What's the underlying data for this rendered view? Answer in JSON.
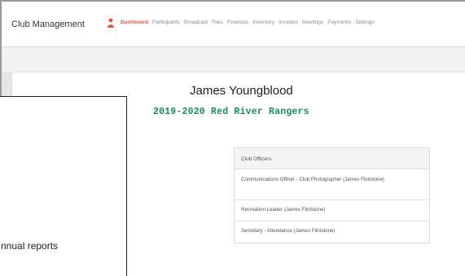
{
  "app": {
    "brand": "Club Management"
  },
  "nav": {
    "items": [
      {
        "label": "Dashboard",
        "active": true
      },
      {
        "label": "Participants",
        "active": false
      },
      {
        "label": "Broadcast",
        "active": false
      },
      {
        "label": "Files",
        "active": false
      },
      {
        "label": "Finances",
        "active": false
      },
      {
        "label": "Inventory",
        "active": false
      },
      {
        "label": "Invoices",
        "active": false
      },
      {
        "label": "Meetings",
        "active": false
      },
      {
        "label": "Payments",
        "active": false
      },
      {
        "label": "Settings",
        "active": false
      }
    ],
    "user_icon": "user-icon"
  },
  "profile": {
    "name": "James Youngblood",
    "team": "2019-2020 Red River Rangers"
  },
  "officers": {
    "header": "Club Officers",
    "items": [
      "Communications Officer - Club Photographer (James Flintstone)",
      "Recreation Leader (James Flintstone)",
      "Secretary - Attendance (James Flintstone)"
    ]
  },
  "callout": {
    "text": "nnual reports"
  },
  "colors": {
    "accent": "#e0563a",
    "team_green": "#1c8a5e"
  }
}
